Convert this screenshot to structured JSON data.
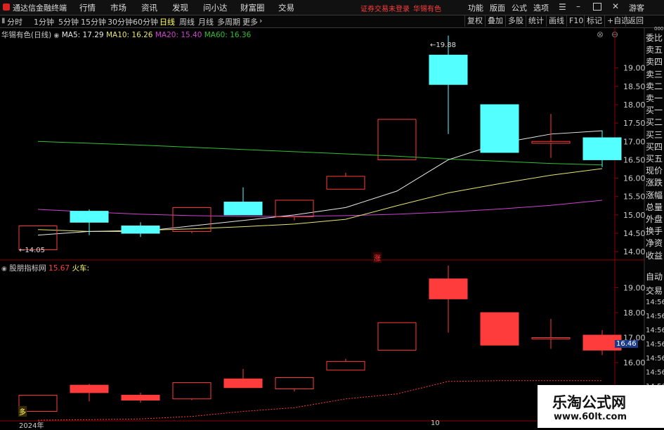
{
  "app": {
    "title": "通达信金融终端",
    "menu": [
      "行情",
      "市场",
      "资讯",
      "发现",
      "问小达",
      "财富圈",
      "交易"
    ],
    "warning": "证券交易未登录",
    "stock_title": "华锡有色",
    "right_menu": [
      "功能",
      "版面",
      "公式",
      "选项"
    ],
    "user": "游客"
  },
  "periods": [
    "分时",
    "1分钟",
    "5分钟",
    "15分钟",
    "30分钟",
    "60分钟",
    "日线",
    "周线",
    "月线",
    "多周期",
    "更多"
  ],
  "active_period": "日线",
  "toolbar": [
    "复权",
    "叠加",
    "多股",
    "统计",
    "画线",
    "F10",
    "标记",
    "+自选",
    "返回"
  ],
  "ma_legend": {
    "stock_label": "华锡有色(日线)",
    "ma5": "MA5: 17.29",
    "ma10": "MA10: 16.26",
    "ma20": "MA20: 15.40",
    "ma60": "MA60: 16.36"
  },
  "indicator_legend": {
    "name": "股朋指标网",
    "value": "15.67",
    "label": "火车:"
  },
  "sidebar_top": [
    "委比",
    "卖五",
    "卖四",
    "卖三",
    "卖二",
    "卖一",
    "买一",
    "买二",
    "买三",
    "买四",
    "买五",
    "现价",
    "涨跌",
    "涨幅",
    "总量",
    "外盘",
    "换手",
    "净资",
    "收益"
  ],
  "sidebar_bottom": [
    "自动",
    "交易",
    "14:56",
    "14:56",
    "14:56",
    "14:56",
    "14:56",
    "14:56",
    "14:56"
  ],
  "sidebar_top_label": "000",
  "annotations": {
    "low": "←14.05",
    "high": "←19.88",
    "rise_mark": "涨",
    "duo_mark": "多"
  },
  "price_tag": "16.46",
  "x_labels": {
    "year": "2024年",
    "month": "10"
  },
  "watermark": {
    "title": "乐淘公式网",
    "url": "www.60lt.com"
  },
  "colors": {
    "up": "#ff3c3c",
    "down": "#54ffff",
    "ma5": "#e8e8e8",
    "ma10": "#e6e66e",
    "ma20": "#d040d0",
    "ma60": "#30c030",
    "bg": "#000000",
    "grid": "#8b0000"
  },
  "chart_data": [
    {
      "type": "candlestick",
      "title": "华锡有色(日线)",
      "y_ticks": [
        19.0,
        18.5,
        18.0,
        17.5,
        17.0,
        16.5,
        16.0,
        15.5,
        15.0,
        14.5,
        14.0
      ],
      "ylim": [
        13.85,
        19.95
      ],
      "candles": [
        {
          "open": 14.05,
          "close": 14.7,
          "high": 14.7,
          "low": 14.05
        },
        {
          "open": 15.1,
          "close": 14.8,
          "high": 15.15,
          "low": 14.45
        },
        {
          "open": 14.7,
          "close": 14.5,
          "high": 14.8,
          "low": 14.4
        },
        {
          "open": 14.55,
          "close": 15.2,
          "high": 15.2,
          "low": 14.5
        },
        {
          "open": 15.35,
          "close": 15.0,
          "high": 15.75,
          "low": 15.0
        },
        {
          "open": 14.95,
          "close": 15.4,
          "high": 15.4,
          "low": 14.85
        },
        {
          "open": 15.7,
          "close": 16.05,
          "high": 16.15,
          "low": 15.7
        },
        {
          "open": 16.5,
          "close": 17.6,
          "high": 17.6,
          "low": 16.5
        },
        {
          "open": 19.35,
          "close": 18.55,
          "high": 19.88,
          "low": 17.2
        },
        {
          "open": 18.0,
          "close": 16.7,
          "high": 18.0,
          "low": 16.7
        },
        {
          "open": 16.95,
          "close": 17.0,
          "high": 17.75,
          "low": 16.55
        },
        {
          "open": 17.1,
          "close": 16.5,
          "high": 17.3,
          "low": 16.3
        }
      ],
      "ma5": [
        14.45,
        14.55,
        14.55,
        14.7,
        14.85,
        15.0,
        15.2,
        15.65,
        16.5,
        16.95,
        17.2,
        17.29
      ],
      "ma10": [
        14.6,
        14.55,
        14.58,
        14.62,
        14.68,
        14.75,
        14.88,
        15.25,
        15.6,
        15.85,
        16.08,
        16.26
      ],
      "ma20": [
        15.15,
        15.08,
        15.02,
        14.98,
        14.96,
        14.96,
        14.98,
        15.02,
        15.08,
        15.16,
        15.26,
        15.4
      ],
      "ma60": [
        17.0,
        16.95,
        16.9,
        16.84,
        16.78,
        16.72,
        16.66,
        16.6,
        16.52,
        16.46,
        16.4,
        16.36
      ]
    },
    {
      "type": "candlestick",
      "title": "股朋指标网",
      "y_ticks": [
        19.0,
        18.0,
        17.0,
        16.0
      ],
      "ylim": [
        13.7,
        19.6
      ],
      "candles": [
        {
          "open": 14.05,
          "close": 14.7,
          "high": 14.7,
          "low": 14.05
        },
        {
          "open": 15.1,
          "close": 14.8,
          "high": 15.15,
          "low": 14.45
        },
        {
          "open": 14.7,
          "close": 14.5,
          "high": 14.8,
          "low": 14.4
        },
        {
          "open": 14.55,
          "close": 15.2,
          "high": 15.2,
          "low": 14.5
        },
        {
          "open": 15.35,
          "close": 15.0,
          "high": 15.75,
          "low": 15.0
        },
        {
          "open": 14.95,
          "close": 15.4,
          "high": 15.4,
          "low": 14.85
        },
        {
          "open": 15.7,
          "close": 16.05,
          "high": 16.15,
          "low": 15.7
        },
        {
          "open": 16.5,
          "close": 17.6,
          "high": 17.6,
          "low": 16.5
        },
        {
          "open": 19.35,
          "close": 18.55,
          "high": 19.88,
          "low": 17.2
        },
        {
          "open": 18.0,
          "close": 16.7,
          "high": 18.0,
          "low": 16.7
        },
        {
          "open": 16.95,
          "close": 17.0,
          "high": 17.75,
          "low": 16.55
        },
        {
          "open": 17.1,
          "close": 16.5,
          "high": 17.3,
          "low": 16.3
        }
      ],
      "filled": [
        false,
        true,
        true,
        false,
        true,
        false,
        false,
        false,
        true,
        true,
        false,
        true
      ],
      "train_line": [
        13.7,
        13.72,
        13.75,
        13.85,
        14.05,
        14.2,
        14.55,
        14.75,
        15.25,
        15.28,
        15.28,
        15.28
      ]
    }
  ]
}
